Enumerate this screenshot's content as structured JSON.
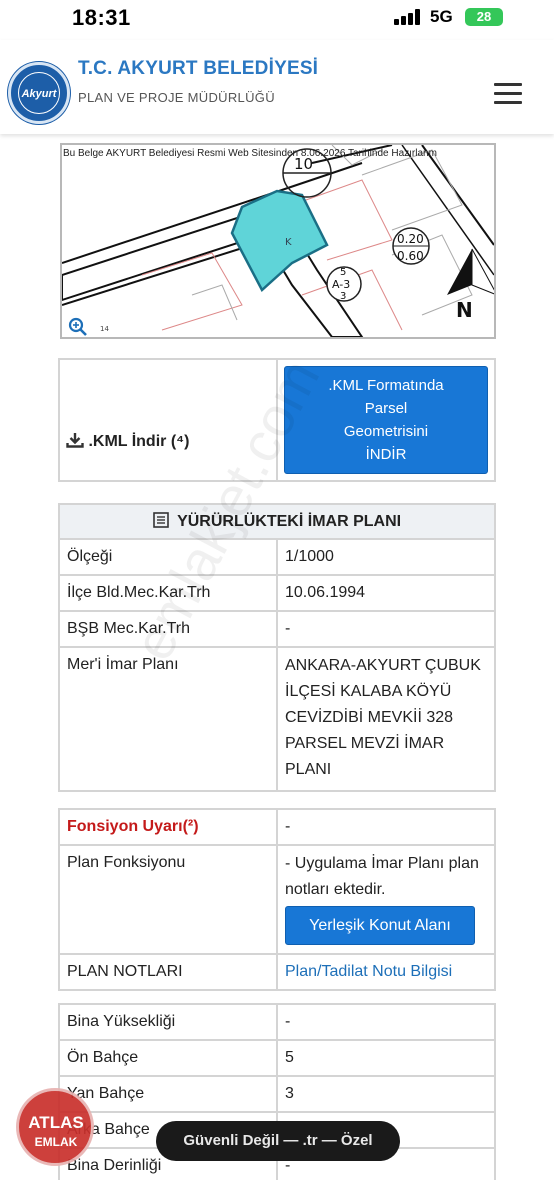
{
  "status_bar": {
    "time": "18:31",
    "network": "5G",
    "battery": "28"
  },
  "header": {
    "org_title": "T.C. AKYURT BELEDİYESİ",
    "org_subtitle": "PLAN VE PROJE MÜDÜRLÜĞÜ",
    "logo_text": "Akyurt"
  },
  "map": {
    "caption": "Bu Belge AKYURT Belediyesi Resmi Web Sitesinden 8.06.2026 Tarihinde Hazırlanm",
    "label_10": "10",
    "label_ratio_top": "0.20",
    "label_ratio_bottom": "0.60",
    "label_a3_top": "5",
    "label_a3_mid": "A-3",
    "label_a3_bottom": "3",
    "label_k": "K",
    "label_north": "N",
    "label_14": "14"
  },
  "kml": {
    "label": ".KML İndir (⁴)",
    "button_line1": ".KML Formatında",
    "button_line2": "Parsel",
    "button_line3": "Geometrisini",
    "button_line4": "İNDİR"
  },
  "imar": {
    "heading": "YÜRÜRLÜKTEKİ İMAR PLANI",
    "rows": [
      {
        "label": "Ölçeği",
        "value": "1/1000"
      },
      {
        "label": "İlçe Bld.Mec.Kar.Trh",
        "value": "10.06.1994"
      },
      {
        "label": "BŞB Mec.Kar.Trh",
        "value": "-"
      }
    ],
    "meri_label": "Mer'i İmar Planı",
    "meri_value": "ANKARA-AKYURT ÇUBUK İLÇESİ KALABA KÖYÜ CEVİZDİBİ MEVKİİ 328 PARSEL MEVZİ İMAR PLANI"
  },
  "fonksiyon": {
    "warning_label": "Fonsiyon Uyarı(²)",
    "warning_value": "-",
    "plan_label": "Plan Fonksiyonu",
    "plan_note": "- Uygulama İmar Planı plan notları ektedir.",
    "plan_button": "Yerleşik Konut Alanı",
    "notes_label": "PLAN NOTLARI",
    "notes_link": "Plan/Tadilat Notu Bilgisi"
  },
  "bina": {
    "rows": [
      {
        "label": "Bina Yüksekliği",
        "value": "-"
      },
      {
        "label": "Ön Bahçe",
        "value": "5"
      },
      {
        "label": "Yan Bahçe",
        "value": "3"
      },
      {
        "label": "Arka Bahçe",
        "value": ""
      },
      {
        "label": "Bina Derinliği",
        "value": "-"
      }
    ]
  },
  "url_bar": {
    "text": "Güvenli Değil — .tr — Özel"
  },
  "watermark": {
    "brand_line1": "ATLAS",
    "brand_line2": "EMLAK",
    "site": "emlakjet.com"
  }
}
